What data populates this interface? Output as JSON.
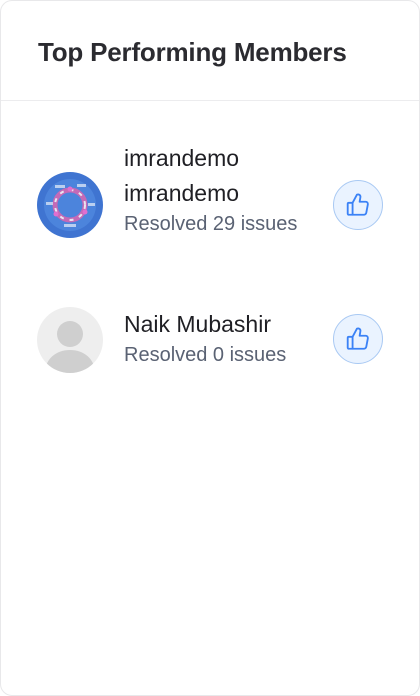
{
  "panel": {
    "title": "Top Performing Members"
  },
  "members": [
    {
      "name": "imrandemo imrandemo",
      "resolved": "Resolved 29 issues",
      "avatar_icon": "profile-photo-icon"
    },
    {
      "name": "Naik Mubashir",
      "resolved": "Resolved 0 issues",
      "avatar_icon": "default-user-icon"
    }
  ],
  "colors": {
    "accent": "#3b82f6",
    "like_bg": "#eaf3ff",
    "like_border": "#a9c9f3"
  }
}
